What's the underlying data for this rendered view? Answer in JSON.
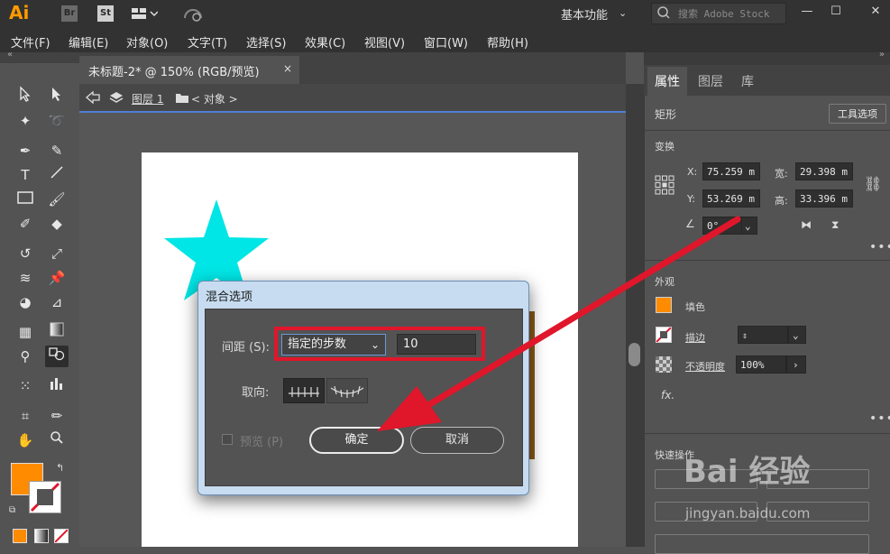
{
  "app": {
    "logo": "Ai",
    "bridge_label": "Br",
    "stock_label": "St",
    "workspace": "基本功能",
    "search_placeholder": "搜索 Adobe Stock"
  },
  "menu": [
    "文件(F)",
    "编辑(E)",
    "对象(O)",
    "文字(T)",
    "选择(S)",
    "效果(C)",
    "视图(V)",
    "窗口(W)",
    "帮助(H)"
  ],
  "document": {
    "tab_title": "未标题-2* @ 150% (RGB/预览)",
    "close_glyph": "×",
    "breadcrumb_layer": "图层 1",
    "breadcrumb_object": "< 对象 >"
  },
  "panel": {
    "tabs": [
      "属性",
      "图层",
      "库"
    ],
    "object_type": "矩形",
    "tool_options_button": "工具选项",
    "transform_title": "变换",
    "x_label": "X:",
    "x_value": "75.259 m",
    "y_label": "Y:",
    "y_value": "53.269 m",
    "w_label": "宽:",
    "w_value": "29.398 m",
    "h_label": "高:",
    "h_value": "33.396 m",
    "angle_value": "0°",
    "appearance_title": "外观",
    "fill_label": "填色",
    "stroke_label": "描边",
    "opacity_label": "不透明度",
    "opacity_value": "100%",
    "fx_label": "fx.",
    "quick_actions_title": "快速操作"
  },
  "dialog": {
    "title": "混合选项",
    "spacing_label": "间距 (S):",
    "spacing_option": "指定的步数",
    "steps_value": "10",
    "orientation_label": "取向:",
    "preview_label": "预览 (P)",
    "ok_label": "确定",
    "cancel_label": "取消"
  },
  "colors": {
    "fill": "#ff8c00",
    "star": "#00e5e5",
    "highlight": "#e0162b",
    "accent": "#4f7fd6"
  },
  "watermark": {
    "brand": "Bai 经验",
    "url": "jingyan.baidu.com"
  }
}
